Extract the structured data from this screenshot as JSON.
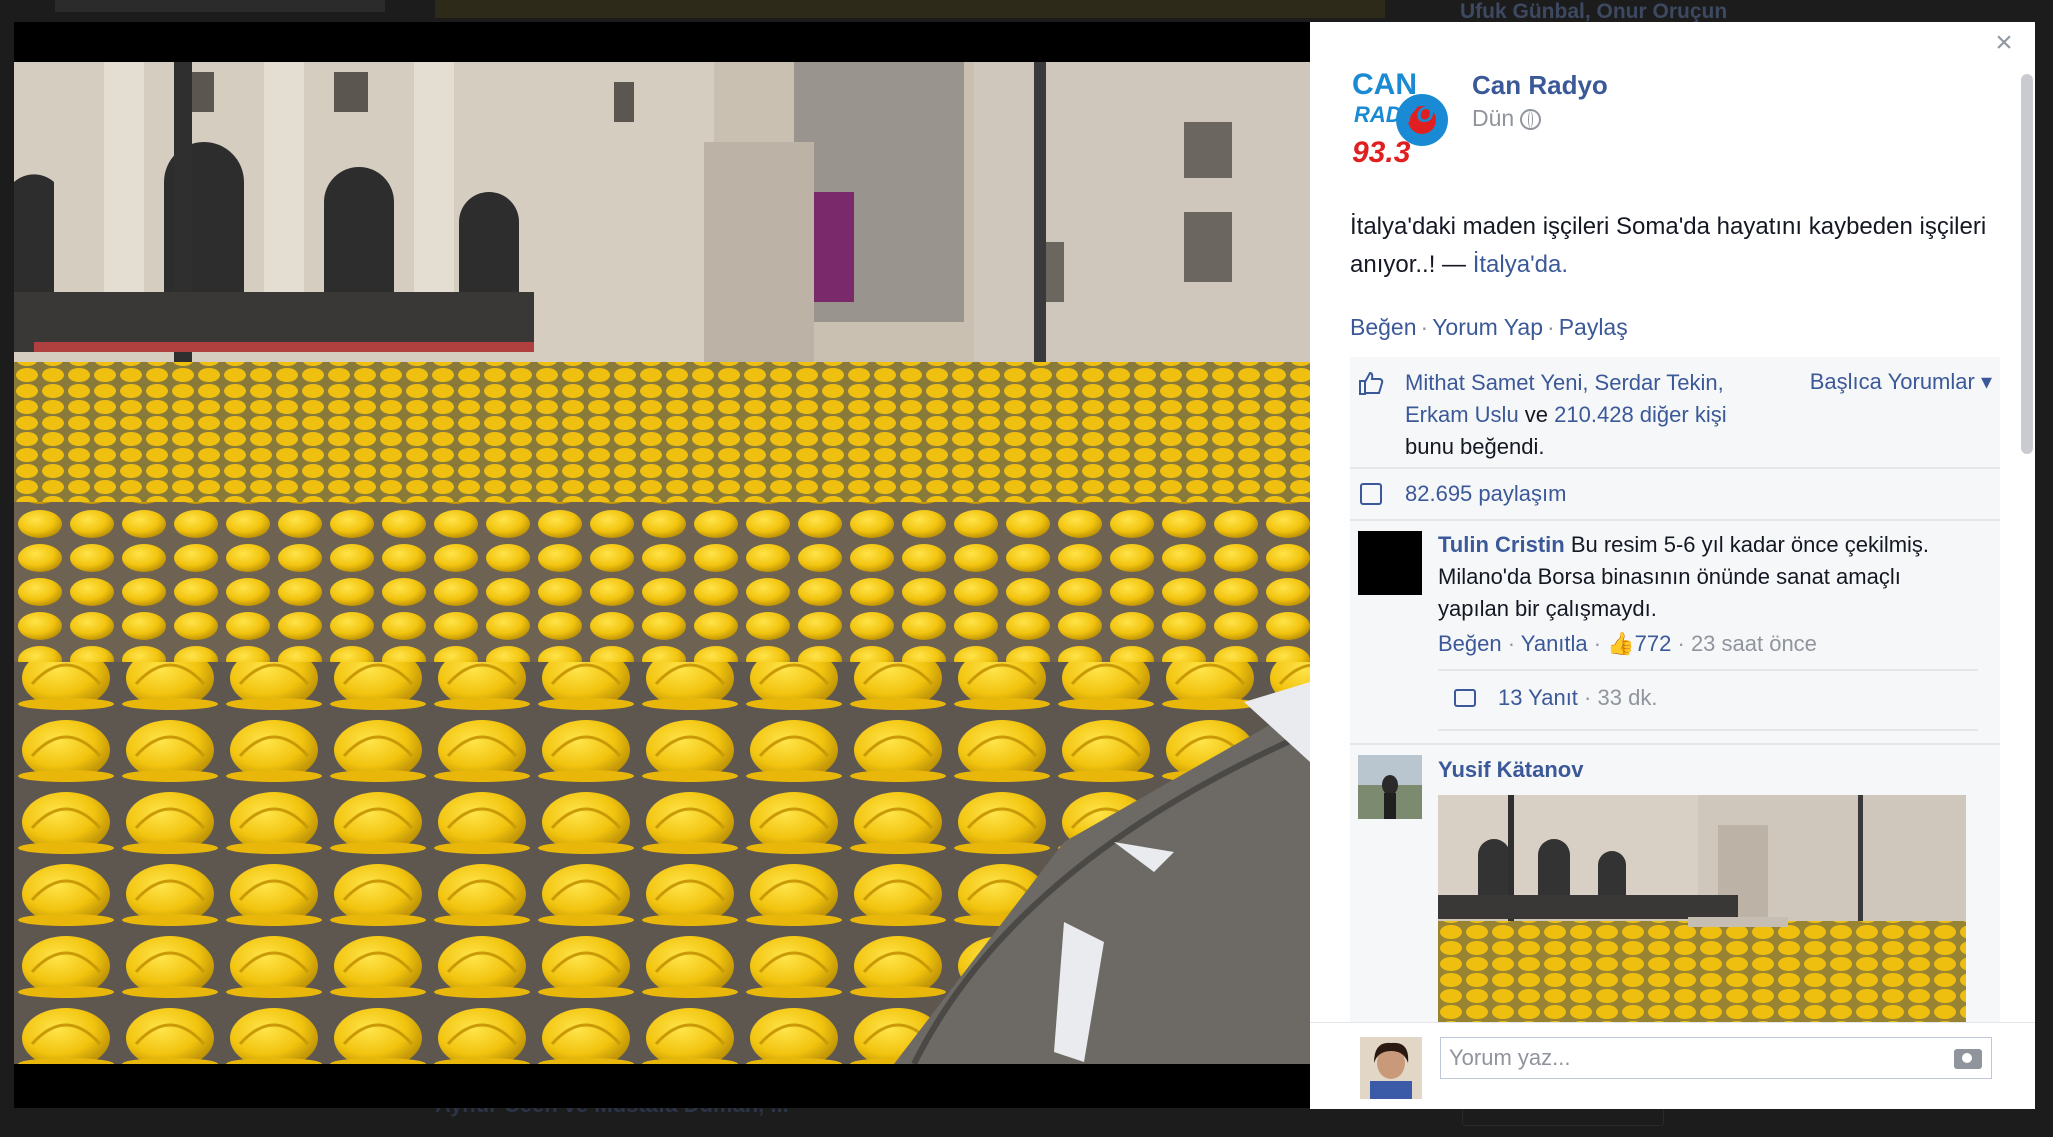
{
  "background_page": {
    "top_right_text": "Ufuk Günbal, Onur Oruçun",
    "bottom_text": "Aynur Ceen ve Mustafa Duman, ..."
  },
  "post": {
    "page_name": "Can Radyo",
    "logo_text_top": "CAN",
    "logo_text_mid": "RADYO",
    "logo_text_freq": "93.3",
    "time": "Dün",
    "text_main": "İtalya'daki maden işçileri Soma'da hayatını kaybeden işçileri anıyor..! — ",
    "location": "İtalya'da.",
    "actions": {
      "like": "Beğen",
      "comment": "Yorum Yap",
      "share": "Paylaş",
      "separator": "·"
    },
    "likes": {
      "names": "Mithat Samet Yeni, Serdar Tekin, Erkam Uslu",
      "and": " ve ",
      "others": "210.428 diğer kişi",
      "suffix": " bunu beğendi."
    },
    "top_comments_label": "Başlıca Yorumlar ▾",
    "shares": "82.695 paylaşım"
  },
  "comments": [
    {
      "name": "Tulin Cristin",
      "text": " Bu resim 5-6 yıl kadar önce çekilmiş. Milano'da Borsa binasının önünde sanat amaçlı yapılan bir çalışmaydı.",
      "like": "Beğen",
      "reply": "Yanıtla",
      "like_count": "772",
      "time": "23 saat önce",
      "replies_label": "13 Yanıt",
      "replies_time": "33 dk."
    },
    {
      "name": "Yusif Kätanov"
    }
  ],
  "composer": {
    "placeholder": "Yorum yaz..."
  },
  "close_label": "×"
}
